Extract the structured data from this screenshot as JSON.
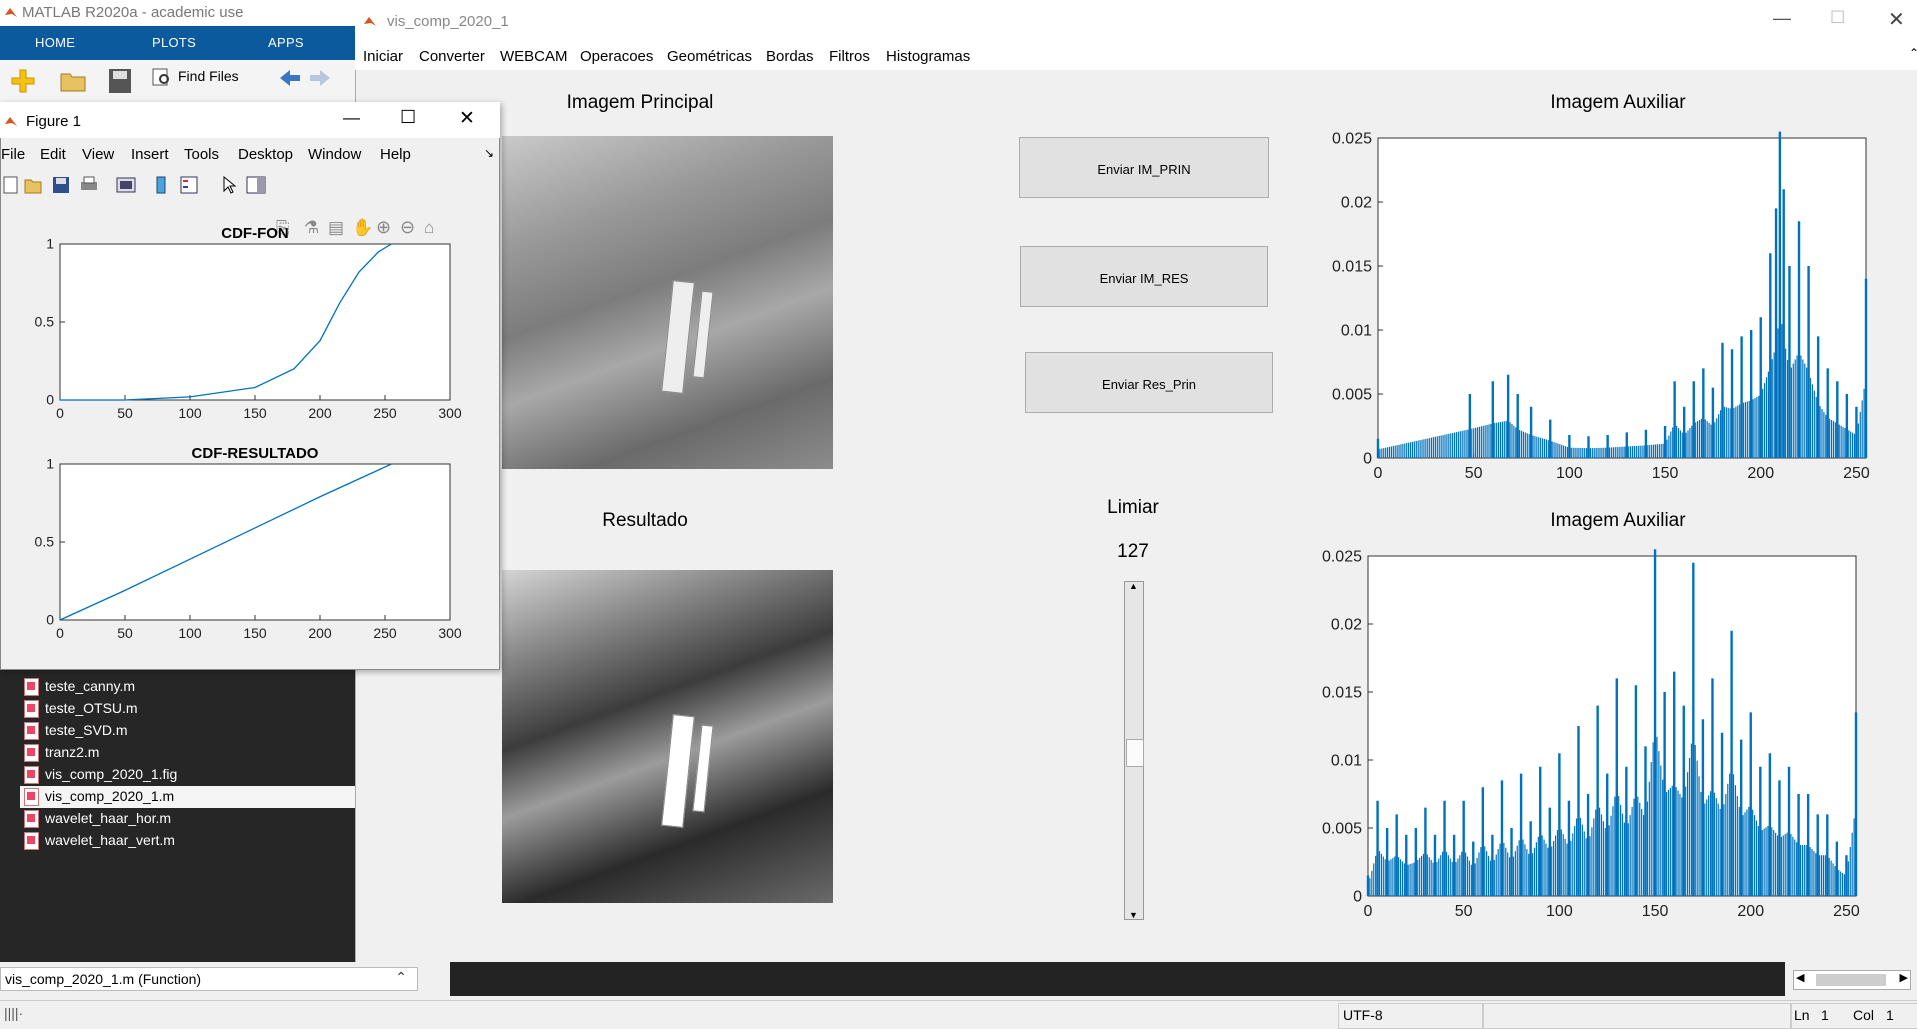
{
  "matlab": {
    "title": "MATLAB R2020a - academic use",
    "tabs": [
      "HOME",
      "PLOTS",
      "APPS"
    ],
    "find_files": "Find Files",
    "files": [
      "teste_canny.m",
      "teste_OTSU.m",
      "teste_SVD.m",
      "tranz2.m",
      "vis_comp_2020_1.fig",
      "vis_comp_2020_1.m",
      "wavelet_haar_hor.m",
      "wavelet_haar_vert.m"
    ],
    "selected_file": "vis_comp_2020_1.m",
    "details": "vis_comp_2020_1.m  (Function)",
    "status": {
      "encoding": "UTF-8",
      "ln_label": "Ln",
      "ln": "1",
      "col_label": "Col",
      "col": "1"
    }
  },
  "vis_window": {
    "title": "vis_comp_2020_1",
    "menu": [
      "Iniciar",
      "Converter",
      "WEBCAM",
      "Operacoes",
      "Geométricas",
      "Bordas",
      "Filtros",
      "Histogramas"
    ],
    "img_main_title": "Imagem Principal",
    "img_result_title": "Resultado",
    "aux_title_1": "Imagem Auxiliar",
    "aux_title_2": "Imagem Auxiliar",
    "buttons": [
      "Enviar IM_PRIN",
      "Enviar IM_RES",
      "Enviar Res_Prin"
    ],
    "threshold_label": "Limiar",
    "threshold_value": "127",
    "slider_position": 0.5
  },
  "figure1": {
    "title": "Figure 1",
    "menu": [
      "File",
      "Edit",
      "View",
      "Insert",
      "Tools",
      "Desktop",
      "Window",
      "Help"
    ]
  },
  "chart_data": [
    {
      "type": "line",
      "title": "CDF-FON",
      "x": [
        0,
        50,
        100,
        150,
        180,
        200,
        215,
        230,
        245,
        255
      ],
      "series": [
        {
          "values": [
            0,
            0,
            0.02,
            0.08,
            0.2,
            0.38,
            0.62,
            0.82,
            0.95,
            1
          ]
        }
      ],
      "xlim": [
        0,
        300
      ],
      "ylim": [
        0,
        1
      ],
      "xticks": [
        "0",
        "50",
        "100",
        "150",
        "200",
        "250",
        "300"
      ],
      "yticks": [
        "0",
        "0.5",
        "1"
      ]
    },
    {
      "type": "line",
      "title": "CDF-RESULTADO",
      "x": [
        0,
        50,
        100,
        150,
        200,
        255
      ],
      "series": [
        {
          "values": [
            0,
            0.19,
            0.39,
            0.59,
            0.79,
            1
          ]
        }
      ],
      "xlim": [
        0,
        300
      ],
      "ylim": [
        0,
        1
      ],
      "xticks": [
        "0",
        "50",
        "100",
        "150",
        "200",
        "250",
        "300"
      ],
      "yticks": [
        "0",
        "0.5",
        "1"
      ]
    },
    {
      "type": "bar",
      "title": "Imagem Auxiliar",
      "x": [
        0,
        48,
        60,
        68,
        73,
        80,
        90,
        100,
        110,
        120,
        130,
        140,
        150,
        155,
        160,
        165,
        170,
        175,
        180,
        185,
        190,
        195,
        200,
        205,
        208,
        210,
        212,
        215,
        220,
        225,
        230,
        235,
        240,
        245,
        250,
        255
      ],
      "series": [
        {
          "values": [
            0.0015,
            0.005,
            0.006,
            0.0065,
            0.005,
            0.004,
            0.003,
            0.0018,
            0.0017,
            0.0018,
            0.002,
            0.0022,
            0.0025,
            0.006,
            0.004,
            0.006,
            0.007,
            0.0055,
            0.009,
            0.0085,
            0.0095,
            0.01,
            0.011,
            0.016,
            0.0195,
            0.0255,
            0.021,
            0.015,
            0.0185,
            0.015,
            0.0095,
            0.007,
            0.006,
            0.005,
            0.004,
            0.014
          ]
        }
      ],
      "xlim": [
        0,
        255
      ],
      "ylim": [
        0,
        0.025
      ],
      "xticks": [
        "0",
        "50",
        "100",
        "150",
        "200",
        "250"
      ],
      "yticks": [
        "0",
        "0.005",
        "0.01",
        "0.015",
        "0.02",
        "0.025"
      ]
    },
    {
      "type": "bar",
      "title": "Imagem Auxiliar",
      "x": [
        0,
        5,
        10,
        15,
        20,
        25,
        30,
        35,
        40,
        45,
        50,
        55,
        60,
        65,
        70,
        75,
        80,
        85,
        90,
        95,
        100,
        105,
        110,
        115,
        120,
        125,
        130,
        135,
        140,
        145,
        150,
        155,
        160,
        165,
        170,
        175,
        180,
        185,
        190,
        195,
        200,
        205,
        210,
        215,
        220,
        225,
        230,
        235,
        240,
        245,
        250,
        255
      ],
      "series": [
        {
          "values": [
            0.0015,
            0.007,
            0.005,
            0.006,
            0.0045,
            0.005,
            0.0065,
            0.0045,
            0.007,
            0.0045,
            0.007,
            0.004,
            0.008,
            0.0045,
            0.0085,
            0.005,
            0.009,
            0.0055,
            0.0095,
            0.0065,
            0.0105,
            0.007,
            0.0125,
            0.0075,
            0.014,
            0.009,
            0.016,
            0.0095,
            0.0155,
            0.011,
            0.0255,
            0.015,
            0.0165,
            0.014,
            0.0245,
            0.013,
            0.016,
            0.012,
            0.0195,
            0.0115,
            0.0135,
            0.0095,
            0.0105,
            0.0085,
            0.0095,
            0.0075,
            0.0075,
            0.006,
            0.006,
            0.004,
            0.003,
            0.0135
          ]
        }
      ],
      "xlim": [
        0,
        255
      ],
      "ylim": [
        0,
        0.025
      ],
      "xticks": [
        "0",
        "50",
        "100",
        "150",
        "200",
        "250"
      ],
      "yticks": [
        "0",
        "0.005",
        "0.01",
        "0.015",
        "0.02",
        "0.025"
      ]
    }
  ]
}
